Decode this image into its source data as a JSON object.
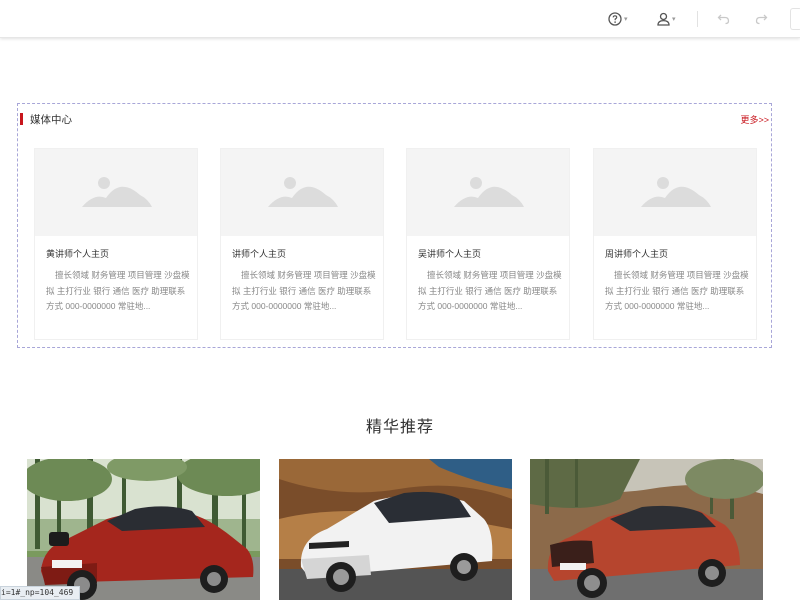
{
  "toolbar": {
    "help_icon": "help-circle-icon",
    "user_icon": "user-icon",
    "undo_icon": "undo-icon",
    "redo_icon": "redo-icon"
  },
  "media_center": {
    "title": "媒体中心",
    "more": "更多>>",
    "accent_color": "#c8161d",
    "cards": [
      {
        "title": "黄讲师个人主页",
        "desc": "擅长领域  财务管理  项目管理  沙盘模拟  主打行业  银行  通信  医疗  助理联系方式  000-0000000  常驻地..."
      },
      {
        "title": "讲师个人主页",
        "desc": "擅长领域  财务管理  项目管理  沙盘模拟  主打行业  银行  通信  医疗  助理联系方式  000-0000000  常驻地..."
      },
      {
        "title": "吴讲师个人主页",
        "desc": "擅长领域  财务管理  项目管理  沙盘模拟  主打行业  银行  通信  医疗  助理联系方式  000-0000000  常驻地..."
      },
      {
        "title": "周讲师个人主页",
        "desc": "擅长领域  财务管理  项目管理  沙盘模拟  主打行业  银行  通信  医疗  助理联系方式  000-0000000  常驻地..."
      }
    ]
  },
  "featured": {
    "title": "精华推荐",
    "photos": [
      {
        "label": "red-suv-coupe"
      },
      {
        "label": "white-suv"
      },
      {
        "label": "red-suv"
      }
    ]
  },
  "status_bar": {
    "text": "i=1#_np=104_469"
  }
}
